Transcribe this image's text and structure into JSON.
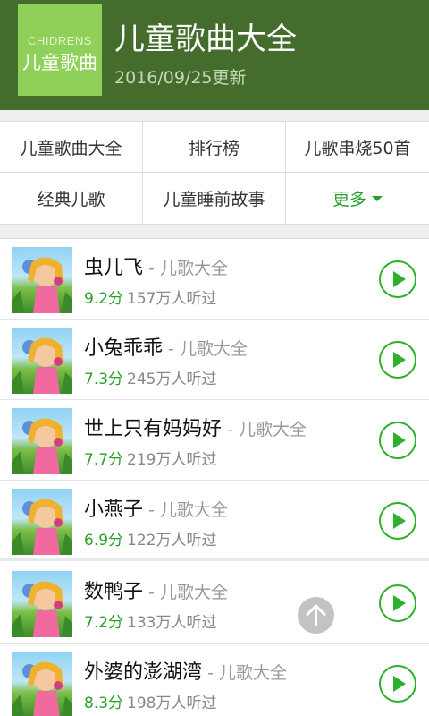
{
  "header": {
    "logo_en": "CHIDRENS",
    "logo_cn": "儿童歌曲",
    "title": "儿童歌曲大全",
    "update_date": "2016/09/25更新"
  },
  "categories": [
    {
      "label": "儿童歌曲大全"
    },
    {
      "label": "排行榜"
    },
    {
      "label": "儿歌串烧50首"
    },
    {
      "label": "经典儿歌"
    },
    {
      "label": "儿童睡前故事"
    },
    {
      "label": "更多"
    }
  ],
  "songs": [
    {
      "title": "虫儿飞",
      "album": "儿歌大全",
      "rating": "9.2分",
      "plays": "157万人听过"
    },
    {
      "title": "小兔乖乖",
      "album": "儿歌大全",
      "rating": "7.3分",
      "plays": "245万人听过"
    },
    {
      "title": "世上只有妈妈好",
      "album": "儿歌大全",
      "rating": "7.7分",
      "plays": "219万人听过"
    },
    {
      "title": "小燕子",
      "album": "儿歌大全",
      "rating": "6.9分",
      "plays": "122万人听过"
    },
    {
      "title": "数鸭子",
      "album": "儿歌大全",
      "rating": "7.2分",
      "plays": "133万人听过"
    },
    {
      "title": "外婆的澎湖湾",
      "album": "儿歌大全",
      "rating": "8.3分",
      "plays": "198万人听过"
    }
  ],
  "colors": {
    "header_bg": "#446c2c",
    "logo_bg": "#8fd058",
    "accent_green": "#2aa02a"
  },
  "icons": {
    "play": "play-circle-icon",
    "more_caret": "caret-down-icon",
    "scroll_top": "arrow-up-icon"
  }
}
